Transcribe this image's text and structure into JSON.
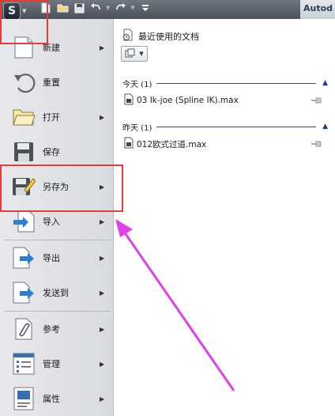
{
  "window": {
    "title_partial": "Autod"
  },
  "quick_access": {
    "icons": [
      "new-file-icon",
      "open-folder-icon",
      "save-icon",
      "undo-icon",
      "redo-icon",
      "customize-icon"
    ]
  },
  "menu": {
    "items": [
      {
        "id": "new",
        "label": "新建",
        "icon": "new-file-icon",
        "has_submenu": true
      },
      {
        "id": "reset",
        "label": "重置",
        "icon": "reset-icon",
        "has_submenu": false
      },
      {
        "id": "open",
        "label": "打开",
        "icon": "open-folder-icon",
        "has_submenu": true
      },
      {
        "id": "save",
        "label": "保存",
        "icon": "save-icon",
        "has_submenu": false
      },
      {
        "id": "save-as",
        "label": "另存为",
        "icon": "save-as-icon",
        "has_submenu": true
      },
      {
        "id": "import",
        "label": "导入",
        "icon": "import-icon",
        "has_submenu": true
      },
      {
        "id": "export",
        "label": "导出",
        "icon": "export-icon",
        "has_submenu": true
      },
      {
        "id": "send-to",
        "label": "发送到",
        "icon": "send-to-icon",
        "has_submenu": true
      },
      {
        "id": "reference",
        "label": "参考",
        "icon": "reference-icon",
        "has_submenu": true
      },
      {
        "id": "manage",
        "label": "管理",
        "icon": "manage-icon",
        "has_submenu": true
      },
      {
        "id": "properties",
        "label": "属性",
        "icon": "properties-icon",
        "has_submenu": true
      }
    ]
  },
  "recent": {
    "title": "最近使用的文档",
    "groups": [
      {
        "label": "今天 (1)",
        "files": [
          {
            "name": "03 Ik-joe (Spline IK).max"
          }
        ]
      },
      {
        "label": "昨天 (1)",
        "files": [
          {
            "name": "012欧式过道.max"
          }
        ]
      }
    ]
  },
  "colors": {
    "annotation_red": "#e53b3b",
    "annotation_magenta": "#e040e8",
    "group_line": "#3a4a8a"
  }
}
